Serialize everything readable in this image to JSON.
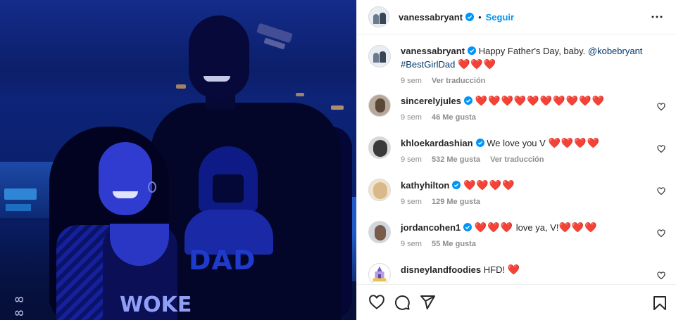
{
  "header": {
    "username": "vanessabryant",
    "separator": "•",
    "follow_label": "Seguir"
  },
  "caption": {
    "username": "vanessabryant",
    "text": "Happy Father's Day, baby.",
    "mention": "@kobebryant",
    "hashtag": "#BestGirlDad",
    "hearts": "❤️❤️❤️",
    "time": "9 sem",
    "translate": "Ver traducción"
  },
  "comments": [
    {
      "username": "sincerelyjules",
      "text": "",
      "hearts": "❤️❤️❤️❤️❤️❤️❤️❤️❤️❤️",
      "time": "9 sem",
      "likes": "46 Me gusta",
      "translate": ""
    },
    {
      "username": "khloekardashian",
      "text": "We love you V",
      "hearts": "❤️❤️❤️❤️",
      "time": "9 sem",
      "likes": "532 Me gusta",
      "translate": "Ver traducción"
    },
    {
      "username": "kathyhilton",
      "text": "",
      "hearts": "❤️❤️❤️❤️",
      "time": "9 sem",
      "likes": "129 Me gusta",
      "translate": ""
    },
    {
      "username": "jordancohen1",
      "text": "love ya, V!",
      "hearts_before": "❤️❤️❤️",
      "hearts": "❤️❤️❤️",
      "time": "9 sem",
      "likes": "55 Me gusta",
      "translate": ""
    },
    {
      "username": "disneylandfoodies",
      "text": "HFD!",
      "hearts": "❤️",
      "time": "",
      "likes": "",
      "translate": ""
    }
  ],
  "photo": {
    "shirt_text": "DAD",
    "top_text": "WOKE",
    "stamp": "8 8"
  },
  "icons": {
    "verified": "verified-badge-icon",
    "more": "more-options-icon",
    "like": "heart-outline-icon",
    "comment": "comment-bubble-icon",
    "share": "paper-plane-icon",
    "save": "bookmark-icon"
  },
  "colors": {
    "follow": "#0095f6",
    "verified": "#0095f6",
    "heart": "#ed1c24",
    "muted": "#8e8e8e",
    "link": "#00376b"
  }
}
